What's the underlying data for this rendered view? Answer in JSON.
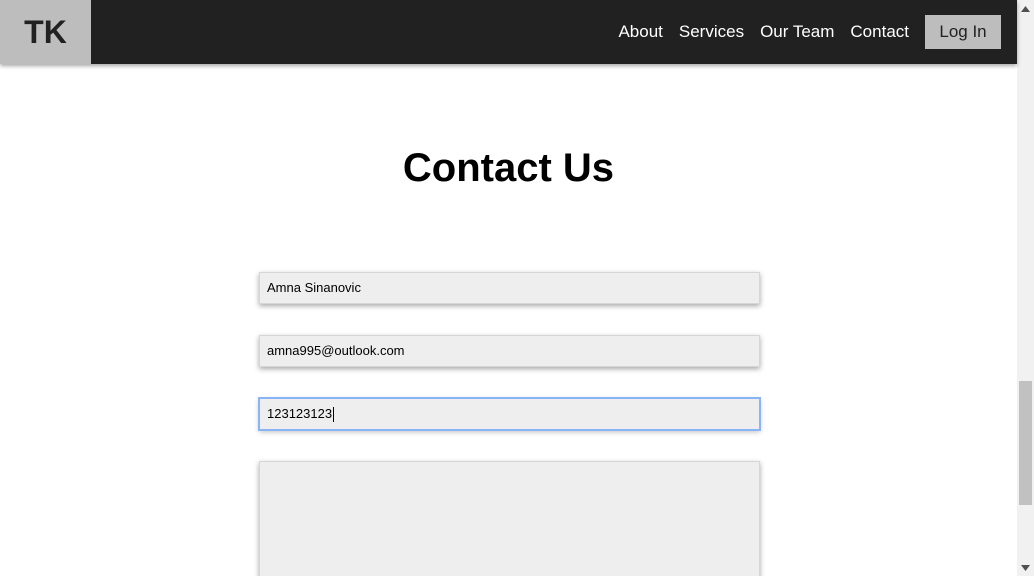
{
  "header": {
    "logo_text": "TK",
    "nav": [
      {
        "label": "About"
      },
      {
        "label": "Services"
      },
      {
        "label": "Our Team"
      },
      {
        "label": "Contact"
      }
    ],
    "login_label": "Log In"
  },
  "main": {
    "title": "Contact Us",
    "form": {
      "name_value": "Amna Sinanovic",
      "email_value": "amna995@outlook.com",
      "phone_value": "123123123",
      "message_value": ""
    }
  },
  "colors": {
    "navbar_bg": "#212121",
    "logo_bg": "#bdbdbd",
    "field_bg": "#eeeeee",
    "focus_border": "#8ab4f8"
  },
  "icons": {
    "scroll_up": "triangle-up-icon",
    "scroll_down": "triangle-down-icon",
    "resize": "resize-grip-icon"
  }
}
